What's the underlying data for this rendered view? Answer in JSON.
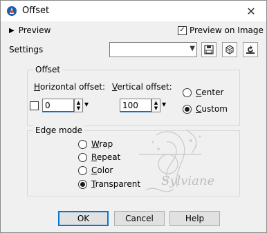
{
  "window": {
    "title": "Offset",
    "close_glyph": "✕",
    "app_icon": "corel-psp-icon",
    "accent": "#0078d7"
  },
  "preview": {
    "toggle_label": "Preview",
    "toggle_icon": "triangle-right-icon",
    "preview_on_image_label": "Preview on Image",
    "preview_on_image_checked": true
  },
  "settings": {
    "label": "Settings",
    "preset_value": "",
    "buttons": [
      "save-preset-icon",
      "randomize-icon",
      "reset-icon"
    ]
  },
  "offset": {
    "group_label": "Offset",
    "horizontal": {
      "prefix": "",
      "accel": "H",
      "rest": "orizontal offset:",
      "value": "0"
    },
    "vertical": {
      "accel": "V",
      "rest": "ertical offset:",
      "value": "100"
    },
    "link_checked": false,
    "center": {
      "accel": "C",
      "rest": "enter",
      "selected": false
    },
    "custom": {
      "accel": "C",
      "rest": "ustom",
      "selected": true
    }
  },
  "edge_mode": {
    "group_label": "Edge mode",
    "options": [
      {
        "accel": "W",
        "rest": "rap",
        "selected": false
      },
      {
        "accel": "R",
        "rest": "epeat",
        "selected": false
      },
      {
        "accel": "C",
        "rest": "olor",
        "selected": false
      },
      {
        "accel": "T",
        "rest": "ransparent",
        "selected": true
      }
    ]
  },
  "buttons": {
    "ok": "OK",
    "cancel": "Cancel",
    "help": "Help"
  },
  "watermark": {
    "text": "Sylviane"
  }
}
